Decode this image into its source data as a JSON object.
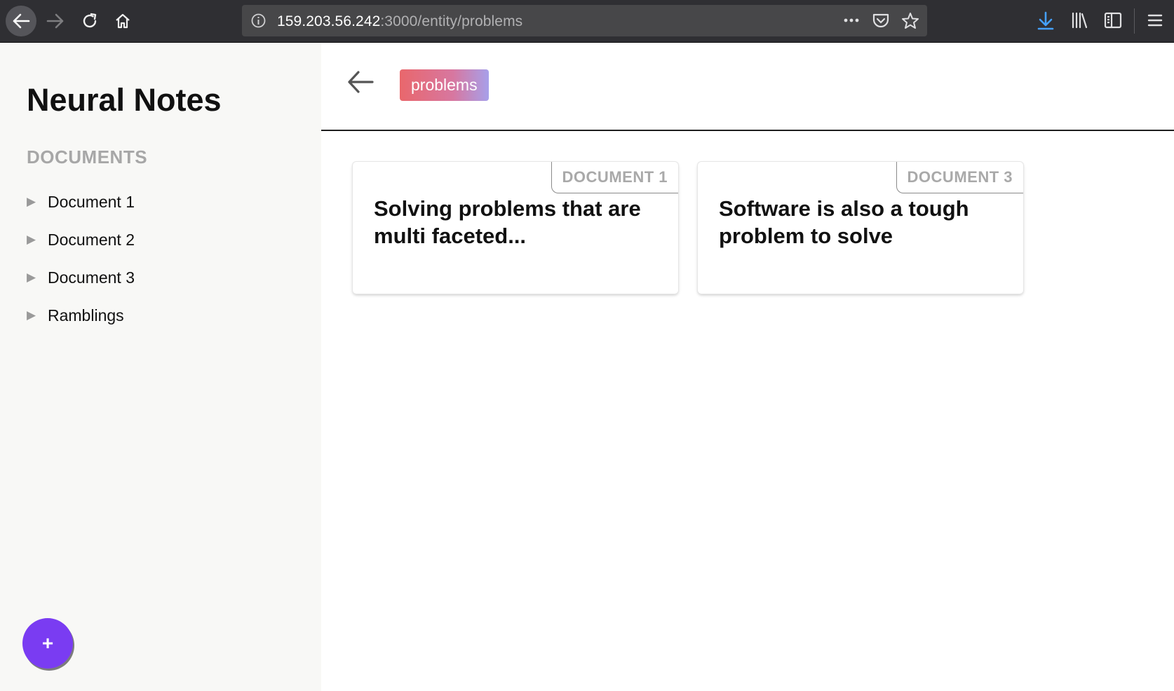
{
  "browser": {
    "url_host": "159.203.56.242",
    "url_rest": ":3000/entity/problems",
    "colors": {
      "chrome": "#2f2f33",
      "urlbar": "#474749",
      "download": "#45a1ff"
    }
  },
  "sidebar": {
    "app_title": "Neural Notes",
    "section_label": "DOCUMENTS",
    "items": [
      {
        "label": "Document 1"
      },
      {
        "label": "Document 2"
      },
      {
        "label": "Document 3"
      },
      {
        "label": "Ramblings"
      }
    ],
    "fab_label": "+",
    "fab_color": "#7a3cf2"
  },
  "main": {
    "entity_tag": "problems",
    "cards": [
      {
        "tag": "DOCUMENT 1",
        "text": "Solving problems that are multi faceted..."
      },
      {
        "tag": "DOCUMENT 3",
        "text": "Software is also a tough problem to solve"
      }
    ]
  }
}
